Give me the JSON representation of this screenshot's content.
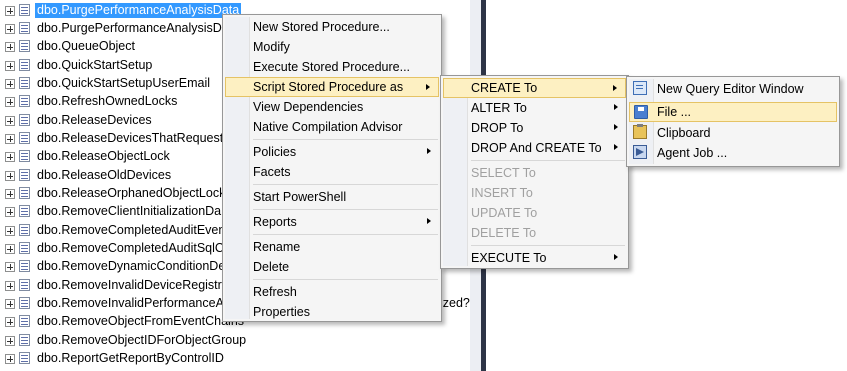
{
  "tree": {
    "items": [
      {
        "label": "dbo.PurgePerformanceAnalysisData",
        "selected": true
      },
      {
        "label": "dbo.PurgePerformanceAnalysisData"
      },
      {
        "label": "dbo.QueueObject"
      },
      {
        "label": "dbo.QuickStartSetup"
      },
      {
        "label": "dbo.QuickStartSetupUserEmail"
      },
      {
        "label": "dbo.RefreshOwnedLocks"
      },
      {
        "label": "dbo.ReleaseDevices"
      },
      {
        "label": "dbo.ReleaseDevicesThatRequeste"
      },
      {
        "label": "dbo.ReleaseObjectLock"
      },
      {
        "label": "dbo.ReleaseOldDevices"
      },
      {
        "label": "dbo.ReleaseOrphanedObjectLocks"
      },
      {
        "label": "dbo.RemoveClientInitializationDa"
      },
      {
        "label": "dbo.RemoveCompletedAuditEven"
      },
      {
        "label": "dbo.RemoveCompletedAuditSqlC"
      },
      {
        "label": "dbo.RemoveDynamicConditionDe"
      },
      {
        "label": "dbo.RemoveInvalidDeviceRegistra"
      },
      {
        "label": "dbo.RemoveInvalidPerformanceA"
      },
      {
        "label": "dbo.RemoveObjectFromEventChains"
      },
      {
        "label": "dbo.RemoveObjectIDForObjectGroup"
      },
      {
        "label": "dbo.ReportGetReportByControlID"
      }
    ],
    "overflow_text": "ized?"
  },
  "context_menu": {
    "items": [
      {
        "label": "New Stored Procedure..."
      },
      {
        "label": "Modify"
      },
      {
        "label": "Execute Stored Procedure..."
      },
      {
        "label": "Script Stored Procedure as",
        "submenu": true,
        "highlighted": true
      },
      {
        "label": "View Dependencies"
      },
      {
        "label": "Native Compilation Advisor"
      },
      {
        "label": "Policies",
        "submenu": true
      },
      {
        "label": "Facets"
      },
      {
        "label": "Start PowerShell"
      },
      {
        "label": "Reports",
        "submenu": true
      },
      {
        "label": "Rename"
      },
      {
        "label": "Delete"
      },
      {
        "label": "Refresh"
      },
      {
        "label": "Properties"
      }
    ]
  },
  "script_submenu": {
    "items": [
      {
        "label": "CREATE To",
        "submenu": true,
        "highlighted": true
      },
      {
        "label": "ALTER To",
        "submenu": true
      },
      {
        "label": "DROP To",
        "submenu": true
      },
      {
        "label": "DROP And CREATE To",
        "submenu": true
      },
      {
        "label": "SELECT To",
        "disabled": true
      },
      {
        "label": "INSERT To",
        "disabled": true
      },
      {
        "label": "UPDATE To",
        "disabled": true
      },
      {
        "label": "DELETE To",
        "disabled": true
      },
      {
        "label": "EXECUTE To",
        "submenu": true
      }
    ]
  },
  "create_submenu": {
    "items": [
      {
        "label": "New Query Editor Window",
        "icon": "query-window-icon"
      },
      {
        "label": "File ...",
        "icon": "save-file-icon",
        "highlighted": true
      },
      {
        "label": "Clipboard",
        "icon": "clipboard-icon"
      },
      {
        "label": "Agent Job ...",
        "icon": "agent-job-icon"
      }
    ]
  },
  "colors": {
    "selection": "#3399ff",
    "menu_highlight": "#fdf0c2",
    "menu_highlight_border": "#e5c365",
    "pane_border": "#2d3446"
  }
}
